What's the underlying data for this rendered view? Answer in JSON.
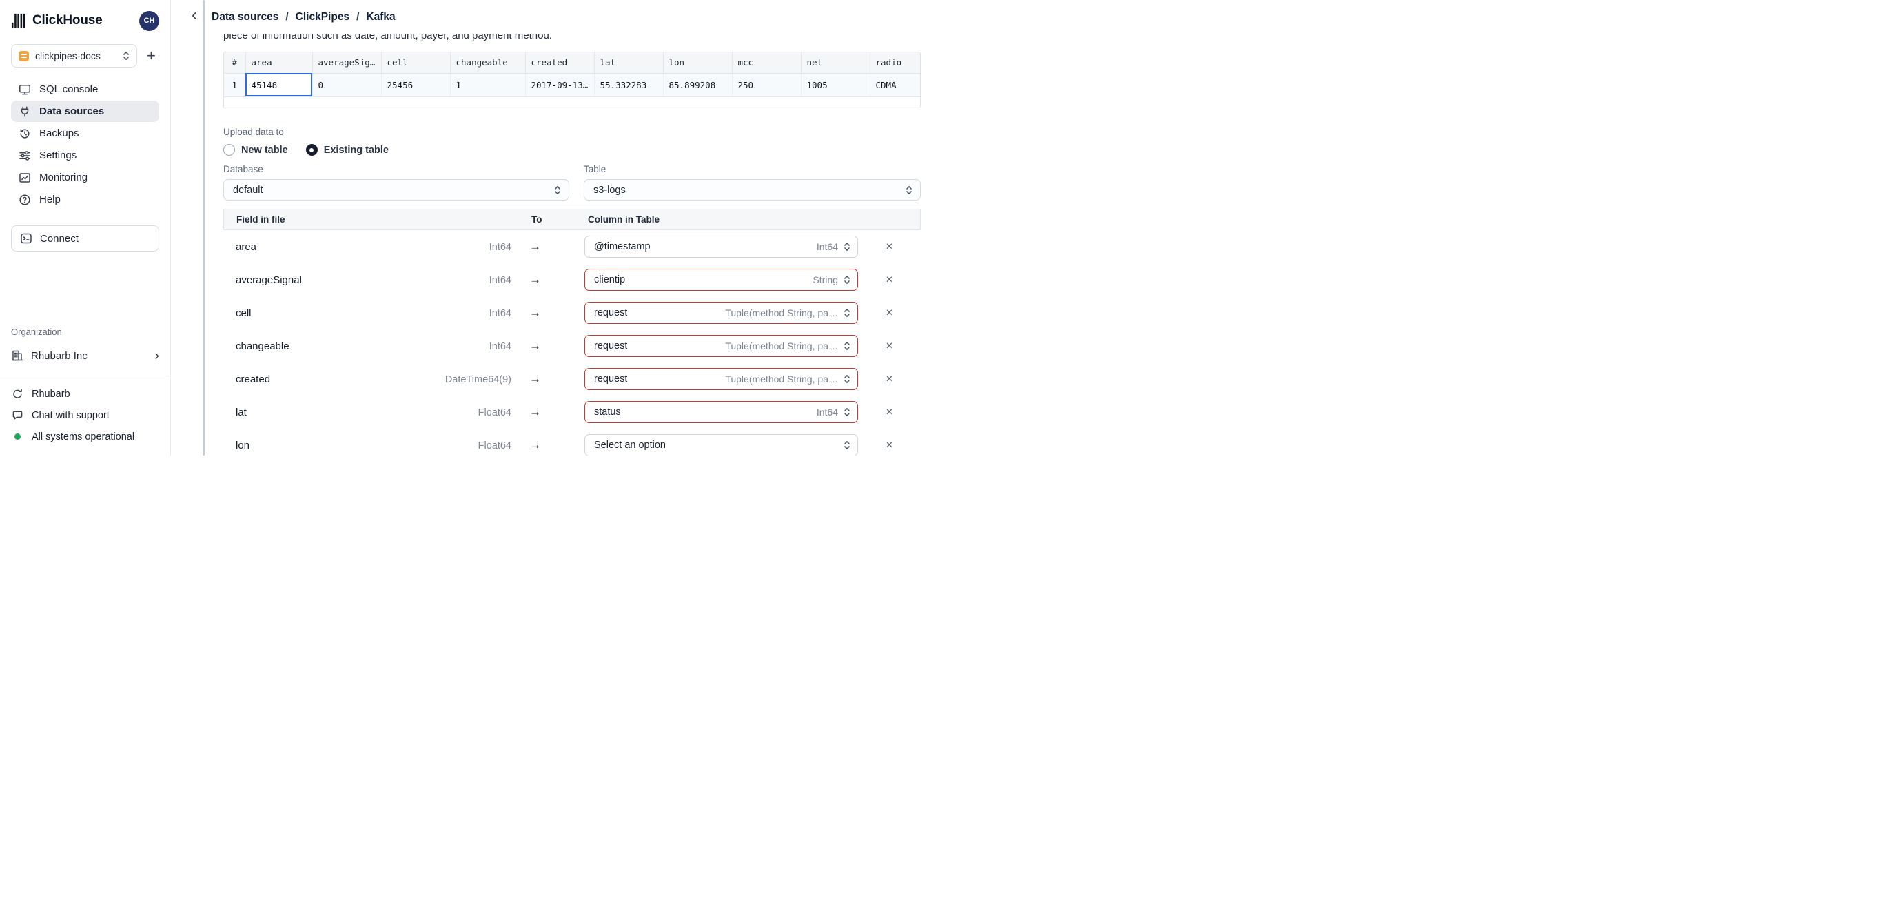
{
  "sidebar": {
    "brand": "ClickHouse",
    "avatar_initials": "CH",
    "service_name": "clickpipes-docs",
    "nav": [
      {
        "label": "SQL console"
      },
      {
        "label": "Data sources",
        "active": true
      },
      {
        "label": "Backups"
      },
      {
        "label": "Settings"
      },
      {
        "label": "Monitoring"
      },
      {
        "label": "Help"
      }
    ],
    "connect_label": "Connect",
    "organization_label": "Organization",
    "organization_name": "Rhubarb Inc",
    "footer_items": [
      {
        "label": "Rhubarb",
        "icon": "rotate-icon"
      },
      {
        "label": "Chat with support",
        "icon": "chat-icon"
      },
      {
        "label": "All systems operational",
        "icon": "status-dot",
        "status_color": "#1fa55b"
      }
    ]
  },
  "header": {
    "breadcrumb": [
      "Data sources",
      "ClickPipes",
      "Kafka"
    ],
    "separator": "/"
  },
  "icons": {
    "plus": "+",
    "back": "‹",
    "chevron_right": "›",
    "arrow": "→",
    "remove": "✕"
  },
  "main": {
    "clipped_sentence": "piece of information such as date, amount, payer, and payment method.",
    "preview": {
      "columns": [
        "#",
        "area",
        "averageSig…",
        "cell",
        "changeable",
        "created",
        "lat",
        "lon",
        "mcc",
        "net",
        "radio"
      ],
      "row": [
        "1",
        "45148",
        "0",
        "25456",
        "1",
        "2017-09-13…",
        "55.332283",
        "85.899208",
        "250",
        "1005",
        "CDMA"
      ],
      "selected_cell": {
        "row": 1,
        "column": "area",
        "value": "45148"
      }
    },
    "upload": {
      "label": "Upload data to",
      "new_table": "New table",
      "existing_table": "Existing table",
      "selected": "Existing table"
    },
    "database": {
      "label": "Database",
      "value": "default"
    },
    "table": {
      "label": "Table",
      "value": "s3-logs"
    },
    "mapping": {
      "headers": {
        "field": "Field in file",
        "to": "To",
        "column": "Column in Table"
      },
      "rows": [
        {
          "field": "area",
          "type": "Int64",
          "column": "@timestamp",
          "column_type": "Int64",
          "error": false
        },
        {
          "field": "averageSignal",
          "type": "Int64",
          "column": "clientip",
          "column_type": "String",
          "error": true
        },
        {
          "field": "cell",
          "type": "Int64",
          "column": "request",
          "column_type": "Tuple(method String, pa…",
          "error": true
        },
        {
          "field": "changeable",
          "type": "Int64",
          "column": "request",
          "column_type": "Tuple(method String, pa…",
          "error": true
        },
        {
          "field": "created",
          "type": "DateTime64(9)",
          "column": "request",
          "column_type": "Tuple(method String, pa…",
          "error": true
        },
        {
          "field": "lat",
          "type": "Float64",
          "column": "status",
          "column_type": "Int64",
          "error": true
        },
        {
          "field": "lon",
          "type": "Float64",
          "column": "Select an option",
          "column_type": "",
          "error": false
        }
      ]
    }
  },
  "colors": {
    "accent_blue": "#2e6be2",
    "error_red": "#c03b33",
    "status_green": "#1fa55b",
    "avatar_bg": "#27336b",
    "service_icon_orange": "#f2a341"
  }
}
